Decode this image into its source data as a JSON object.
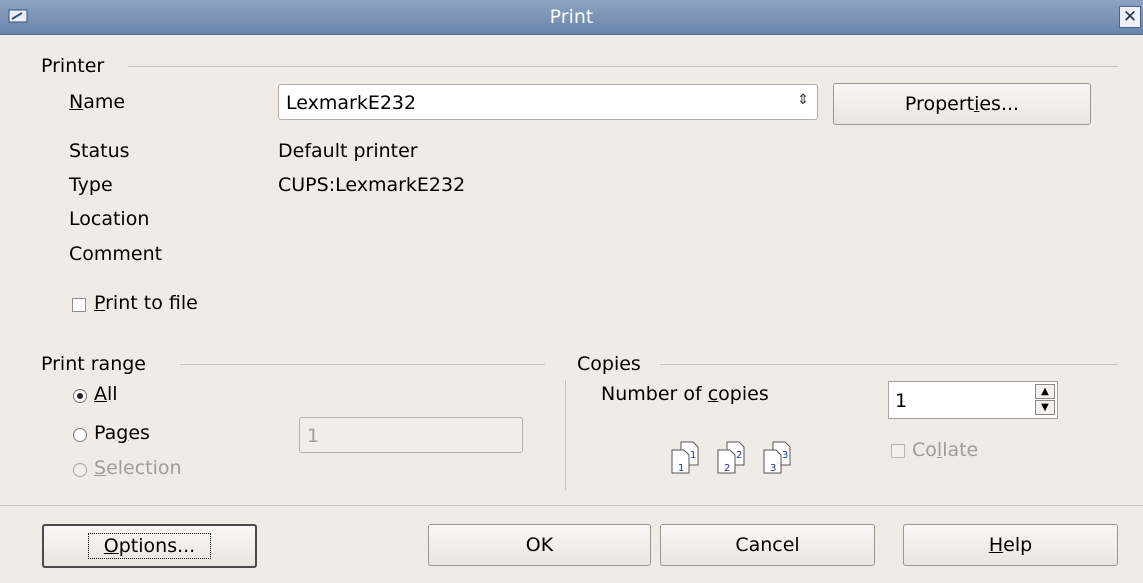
{
  "window": {
    "title": "Print"
  },
  "printer": {
    "legend": "Printer",
    "name_label": "Name",
    "name_value": "LexmarkE232",
    "properties_button": "Properties...",
    "status_label": "Status",
    "status_value": "Default printer",
    "type_label": "Type",
    "type_value": "CUPS:LexmarkE232",
    "location_label": "Location",
    "comment_label": "Comment",
    "print_to_file_label": "Print to file"
  },
  "range": {
    "legend": "Print range",
    "all_label": "All",
    "pages_label": "Pages",
    "pages_value": "1",
    "selection_label": "Selection"
  },
  "copies": {
    "legend": "Copies",
    "number_label": "Number of copies",
    "number_value": "1",
    "collate_label": "Collate",
    "page_numbers": [
      "1",
      "2",
      "3"
    ]
  },
  "buttons": {
    "options": "Options...",
    "ok": "OK",
    "cancel": "Cancel",
    "help": "Help"
  }
}
